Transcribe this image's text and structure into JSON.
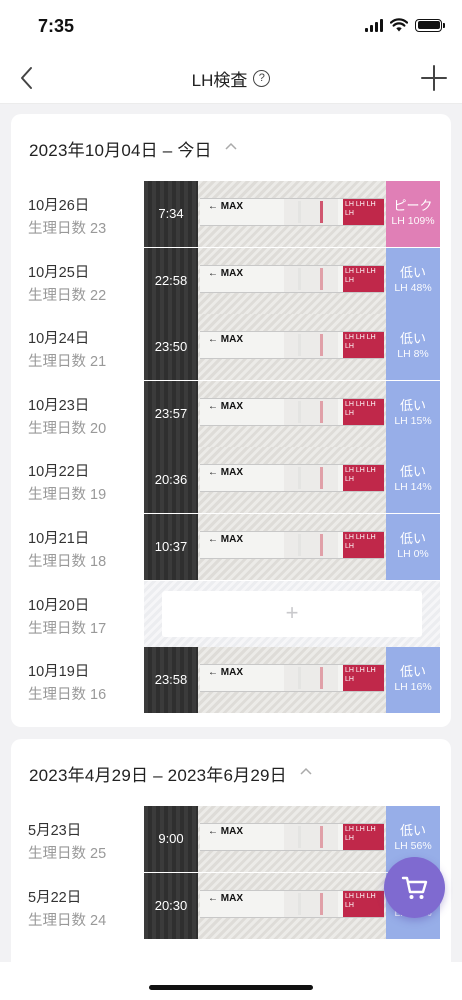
{
  "status_bar": {
    "time": "7:35"
  },
  "nav": {
    "title": "LH検査",
    "help_icon": "?"
  },
  "colors": {
    "peak": "#e07fb6",
    "low": "#97aee8",
    "fab": "#7f6ad0"
  },
  "strip_text": {
    "max": "← MAX",
    "lh": "LH LH LH LH"
  },
  "sections": [
    {
      "title": "2023年10月04日 – 今日",
      "rows": [
        {
          "date": "10月26日",
          "day": "生理日数 23",
          "time": "7:34",
          "label": "ピーク",
          "lh": "LH 109%",
          "level": "peak"
        },
        {
          "date": "10月25日",
          "day": "生理日数 22",
          "time": "22:58",
          "label": "低い",
          "lh": "LH 48%",
          "level": "low"
        },
        {
          "date": "10月24日",
          "day": "生理日数 21",
          "time": "23:50",
          "label": "低い",
          "lh": "LH 8%",
          "level": "low"
        },
        {
          "date": "10月23日",
          "day": "生理日数 20",
          "time": "23:57",
          "label": "低い",
          "lh": "LH 15%",
          "level": "low"
        },
        {
          "date": "10月22日",
          "day": "生理日数 19",
          "time": "20:36",
          "label": "低い",
          "lh": "LH 14%",
          "level": "low"
        },
        {
          "date": "10月21日",
          "day": "生理日数 18",
          "time": "10:37",
          "label": "低い",
          "lh": "LH 0%",
          "level": "low"
        },
        {
          "date": "10月20日",
          "day": "生理日数 17",
          "empty": true,
          "add_label": "+"
        },
        {
          "date": "10月19日",
          "day": "生理日数 16",
          "time": "23:58",
          "label": "低い",
          "lh": "LH 16%",
          "level": "low"
        }
      ]
    },
    {
      "title": "2023年4月29日 – 2023年6月29日",
      "rows": [
        {
          "date": "5月23日",
          "day": "生理日数 25",
          "time": "9:00",
          "label": "低い",
          "lh": "LH 56%",
          "level": "low"
        },
        {
          "date": "5月22日",
          "day": "生理日数 24",
          "time": "20:30",
          "label": "低い",
          "lh": "LH 10%",
          "level": "low"
        }
      ]
    }
  ]
}
